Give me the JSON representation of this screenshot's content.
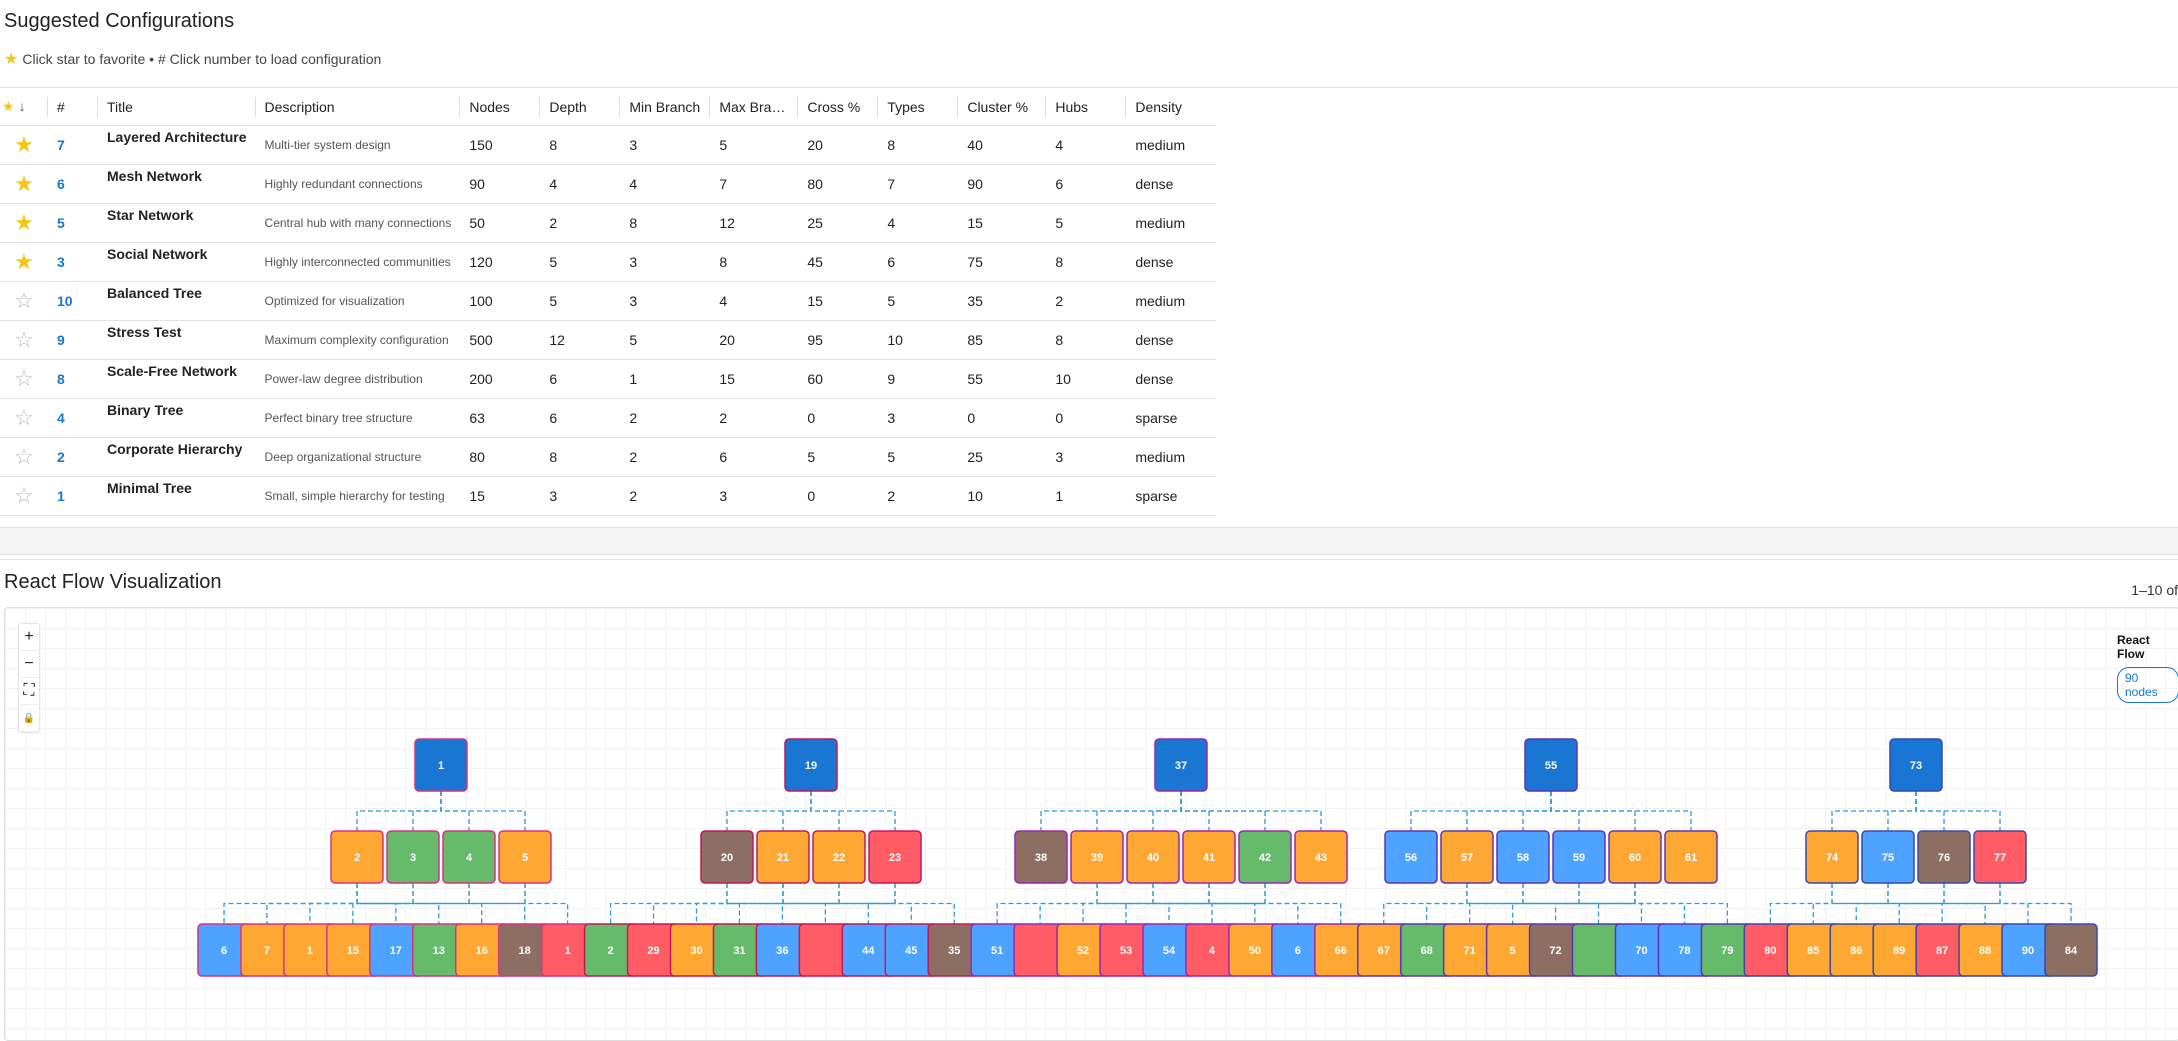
{
  "header": {
    "title": "Suggested Configurations",
    "hint_icon": "star-icon",
    "hint": "Click star to favorite • # Click number to load configuration"
  },
  "colors": {
    "star": "#f5c518",
    "link": "#1976d2",
    "root": "#1976d2",
    "orange": "#ffa733",
    "green": "#66bb6a",
    "blue": "#4da3ff",
    "red": "#ff5c66",
    "brown": "#8d6e63"
  },
  "table": {
    "columns": [
      {
        "key": "fav",
        "label": "",
        "icon": "star-sort-icon"
      },
      {
        "key": "num",
        "label": "#"
      },
      {
        "key": "title",
        "label": "Title"
      },
      {
        "key": "desc",
        "label": "Description"
      },
      {
        "key": "nodes",
        "label": "Nodes"
      },
      {
        "key": "depth",
        "label": "Depth"
      },
      {
        "key": "minb",
        "label": "Min Branch"
      },
      {
        "key": "maxb",
        "label": "Max Bra…"
      },
      {
        "key": "cross",
        "label": "Cross %"
      },
      {
        "key": "types",
        "label": "Types"
      },
      {
        "key": "cluster",
        "label": "Cluster %"
      },
      {
        "key": "hubs",
        "label": "Hubs"
      },
      {
        "key": "density",
        "label": "Density"
      }
    ],
    "rows": [
      {
        "fav": true,
        "num": "7",
        "title": "Layered Architecture",
        "desc": "Multi-tier system design",
        "nodes": "150",
        "depth": "8",
        "minb": "3",
        "maxb": "5",
        "cross": "20",
        "types": "8",
        "cluster": "40",
        "hubs": "4",
        "density": "medium"
      },
      {
        "fav": true,
        "num": "6",
        "title": "Mesh Network",
        "desc": "Highly redundant connections",
        "nodes": "90",
        "depth": "4",
        "minb": "4",
        "maxb": "7",
        "cross": "80",
        "types": "7",
        "cluster": "90",
        "hubs": "6",
        "density": "dense"
      },
      {
        "fav": true,
        "num": "5",
        "title": "Star Network",
        "desc": "Central hub with many connections",
        "nodes": "50",
        "depth": "2",
        "minb": "8",
        "maxb": "12",
        "cross": "25",
        "types": "4",
        "cluster": "15",
        "hubs": "5",
        "density": "medium"
      },
      {
        "fav": true,
        "num": "3",
        "title": "Social Network",
        "desc": "Highly interconnected communities",
        "nodes": "120",
        "depth": "5",
        "minb": "3",
        "maxb": "8",
        "cross": "45",
        "types": "6",
        "cluster": "75",
        "hubs": "8",
        "density": "dense"
      },
      {
        "fav": false,
        "num": "10",
        "title": "Balanced Tree",
        "desc": "Optimized for visualization",
        "nodes": "100",
        "depth": "5",
        "minb": "3",
        "maxb": "4",
        "cross": "15",
        "types": "5",
        "cluster": "35",
        "hubs": "2",
        "density": "medium"
      },
      {
        "fav": false,
        "num": "9",
        "title": "Stress Test",
        "desc": "Maximum complexity configuration",
        "nodes": "500",
        "depth": "12",
        "minb": "5",
        "maxb": "20",
        "cross": "95",
        "types": "10",
        "cluster": "85",
        "hubs": "8",
        "density": "dense"
      },
      {
        "fav": false,
        "num": "8",
        "title": "Scale-Free Network",
        "desc": "Power-law degree distribution",
        "nodes": "200",
        "depth": "6",
        "minb": "1",
        "maxb": "15",
        "cross": "60",
        "types": "9",
        "cluster": "55",
        "hubs": "10",
        "density": "dense"
      },
      {
        "fav": false,
        "num": "4",
        "title": "Binary Tree",
        "desc": "Perfect binary tree structure",
        "nodes": "63",
        "depth": "6",
        "minb": "2",
        "maxb": "2",
        "cross": "0",
        "types": "3",
        "cluster": "0",
        "hubs": "0",
        "density": "sparse"
      },
      {
        "fav": false,
        "num": "2",
        "title": "Corporate Hierarchy",
        "desc": "Deep organizational structure",
        "nodes": "80",
        "depth": "8",
        "minb": "2",
        "maxb": "6",
        "cross": "5",
        "types": "5",
        "cluster": "25",
        "hubs": "3",
        "density": "medium"
      },
      {
        "fav": false,
        "num": "1",
        "title": "Minimal Tree",
        "desc": "Small, simple hierarchy for testing",
        "nodes": "15",
        "depth": "3",
        "minb": "2",
        "maxb": "3",
        "cross": "0",
        "types": "2",
        "cluster": "10",
        "hubs": "1",
        "density": "sparse"
      }
    ],
    "pagination": "1–10 of"
  },
  "flow": {
    "title": "React Flow Visualization",
    "controls": [
      {
        "name": "zoom-in-button",
        "icon": "plus-icon",
        "glyph": "+"
      },
      {
        "name": "zoom-out-button",
        "icon": "minus-icon",
        "glyph": "−"
      },
      {
        "name": "fit-view-button",
        "icon": "fit-view-icon",
        "glyph": "⛶"
      },
      {
        "name": "lock-button",
        "icon": "lock-icon",
        "glyph": "🔒"
      }
    ],
    "panel_title": "React Flow",
    "panel_badge": "90 nodes",
    "roots": [
      {
        "label": "1",
        "color": "root",
        "children": [
          [
            "2",
            "orange"
          ],
          [
            "3",
            "green"
          ],
          [
            "4",
            "green"
          ],
          [
            "5",
            "orange"
          ]
        ]
      },
      {
        "label": "19",
        "color": "root",
        "children": [
          [
            "20",
            "brown"
          ],
          [
            "21",
            "orange"
          ],
          [
            "22",
            "orange"
          ],
          [
            "23",
            "red"
          ]
        ]
      },
      {
        "label": "37",
        "color": "root",
        "children": [
          [
            "38",
            "brown"
          ],
          [
            "39",
            "orange"
          ],
          [
            "40",
            "orange"
          ],
          [
            "41",
            "orange"
          ],
          [
            "42",
            "green"
          ],
          [
            "43",
            "orange"
          ]
        ]
      },
      {
        "label": "55",
        "color": "root",
        "children": [
          [
            "56",
            "blue"
          ],
          [
            "57",
            "orange"
          ],
          [
            "58",
            "blue"
          ],
          [
            "59",
            "blue"
          ],
          [
            "60",
            "orange"
          ],
          [
            "61",
            "orange"
          ]
        ]
      },
      {
        "label": "73",
        "color": "root",
        "children": [
          [
            "74",
            "orange"
          ],
          [
            "75",
            "blue"
          ],
          [
            "76",
            "brown"
          ],
          [
            "77",
            "red"
          ]
        ]
      }
    ],
    "leaves": [
      [
        "6",
        "blue"
      ],
      [
        "7",
        "orange"
      ],
      [
        "1",
        "orange"
      ],
      [
        "15",
        "orange"
      ],
      [
        "17",
        "blue"
      ],
      [
        "13",
        "green"
      ],
      [
        "16",
        "orange"
      ],
      [
        "18",
        "brown"
      ],
      [
        "1",
        "red"
      ],
      [
        "2",
        "green"
      ],
      [
        "29",
        "red"
      ],
      [
        "30",
        "orange"
      ],
      [
        "31",
        "green"
      ],
      [
        "36",
        "blue"
      ],
      [
        "",
        "red"
      ],
      [
        "44",
        "blue"
      ],
      [
        "45",
        "blue"
      ],
      [
        "35",
        "brown"
      ],
      [
        "51",
        "blue"
      ],
      [
        "",
        "red"
      ],
      [
        "52",
        "orange"
      ],
      [
        "53",
        "red"
      ],
      [
        "54",
        "blue"
      ],
      [
        "4",
        "red"
      ],
      [
        "50",
        "orange"
      ],
      [
        "6",
        "blue"
      ],
      [
        "66",
        "orange"
      ],
      [
        "67",
        "orange"
      ],
      [
        "68",
        "green"
      ],
      [
        "71",
        "orange"
      ],
      [
        "5",
        "orange"
      ],
      [
        "72",
        "brown"
      ],
      [
        "",
        "green"
      ],
      [
        "70",
        "blue"
      ],
      [
        "78",
        "blue"
      ],
      [
        "79",
        "green"
      ],
      [
        "80",
        "red"
      ],
      [
        "85",
        "orange"
      ],
      [
        "86",
        "orange"
      ],
      [
        "89",
        "orange"
      ],
      [
        "87",
        "red"
      ],
      [
        "88",
        "orange"
      ],
      [
        "90",
        "blue"
      ],
      [
        "84",
        "brown"
      ]
    ]
  }
}
